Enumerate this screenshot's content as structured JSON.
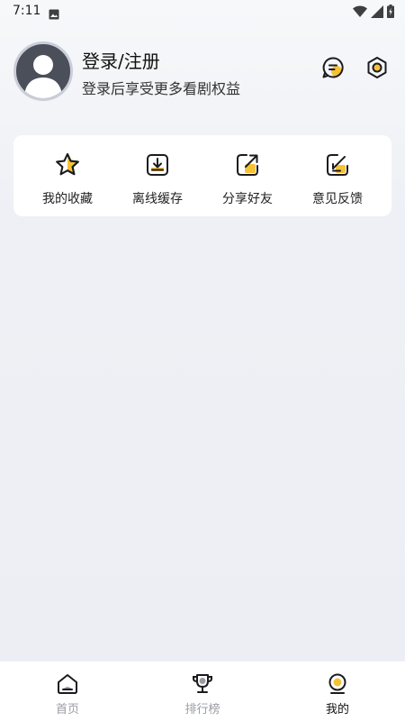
{
  "status_bar": {
    "time": "7:11",
    "icons": [
      "image-icon",
      "wifi-icon",
      "signal-icon",
      "battery-icon"
    ]
  },
  "profile": {
    "title": "登录/注册",
    "subtitle": "登录后享受更多看剧权益",
    "header_icons": [
      "message-icon",
      "settings-icon"
    ]
  },
  "quick_actions": [
    {
      "label": "我的收藏",
      "icon": "star-icon"
    },
    {
      "label": "离线缓存",
      "icon": "download-icon"
    },
    {
      "label": "分享好友",
      "icon": "share-icon"
    },
    {
      "label": "意见反馈",
      "icon": "feedback-icon"
    }
  ],
  "bottom_nav": [
    {
      "label": "首页",
      "icon": "home-icon",
      "active": false
    },
    {
      "label": "排行榜",
      "icon": "trophy-icon",
      "active": false
    },
    {
      "label": "我的",
      "icon": "profile-icon",
      "active": true
    }
  ],
  "colors": {
    "accent": "#f6c235",
    "icon_stroke": "#1b1b1f",
    "inactive_text": "#9a9ca3"
  }
}
